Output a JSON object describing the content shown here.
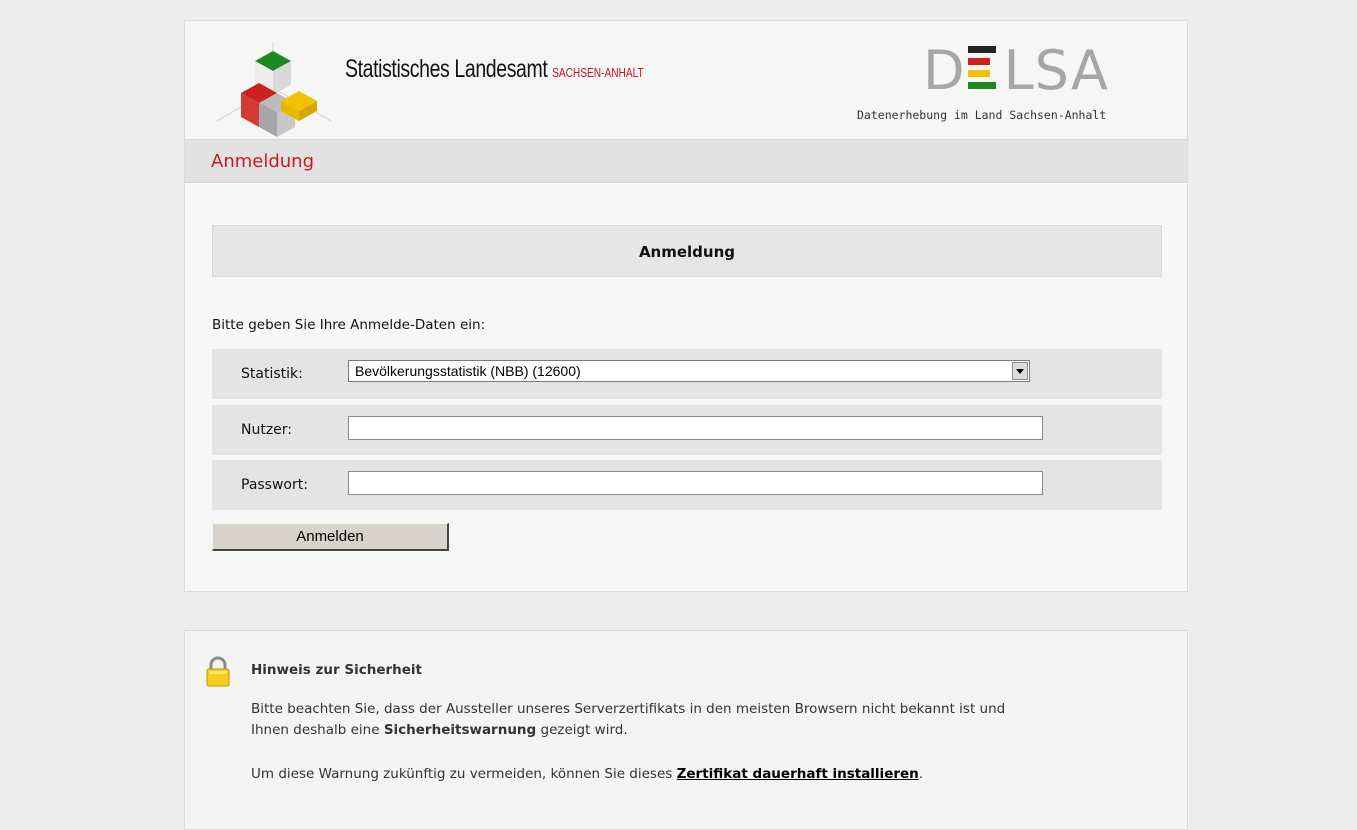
{
  "header": {
    "org_name": "Statistisches Landesamt",
    "org_region": "SACHSEN-ANHALT",
    "app_logo_left": "D",
    "app_logo_right": "LSA",
    "app_tagline": "Datenerhebung im Land Sachsen-Anhalt",
    "logo_colors": {
      "green": "#1e8a1e",
      "red": "#cc1f1f",
      "yellow": "#f2c100",
      "grey": "#b0b0b0"
    }
  },
  "section": {
    "title": "Anmeldung"
  },
  "form": {
    "heading": "Anmeldung",
    "intro": "Bitte geben Sie Ihre Anmelde-Daten ein:",
    "statistik_label": "Statistik:",
    "statistik_value": "Bevölkerungsstatistik (NBB) (12600)",
    "nutzer_label": "Nutzer:",
    "nutzer_value": "",
    "passwort_label": "Passwort:",
    "passwort_value": "",
    "submit_label": "Anmelden"
  },
  "notice": {
    "title": "Hinweis zur Sicherheit",
    "line1_pre": "Bitte beachten Sie, dass der Aussteller unseres Serverzertifikats in den meisten Browsern nicht bekannt ist und",
    "line2_pre": "Ihnen deshalb eine ",
    "line2_bold": "Sicherheitswarnung",
    "line2_post": " gezeigt wird.",
    "line3_pre": "Um diese Warnung zukünftig zu vermeiden, können Sie dieses ",
    "line3_link": "Zertifikat dauerhaft installieren",
    "line3_post": "."
  },
  "colors": {
    "accent_red": "#cc1b1b",
    "page_bg": "#ededed"
  }
}
